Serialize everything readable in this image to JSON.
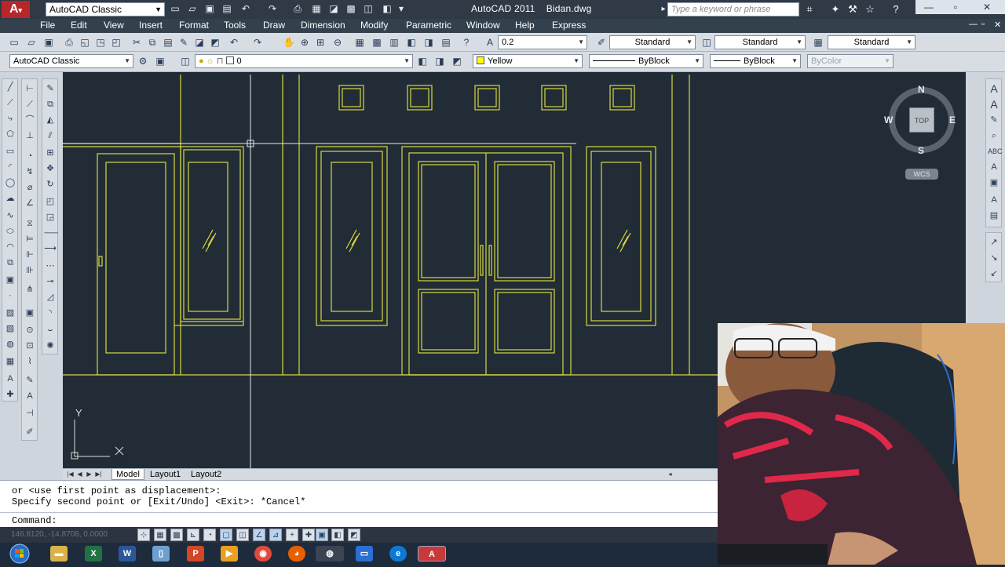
{
  "titlebar": {
    "workspace": "AutoCAD Classic",
    "app_title": "AutoCAD 2011",
    "doc_title": "Bidan.dwg",
    "search_placeholder": "Type a keyword or phrase"
  },
  "menu": [
    "File",
    "Edit",
    "View",
    "Insert",
    "Format",
    "Tools",
    "Draw",
    "Dimension",
    "Modify",
    "Parametric",
    "Window",
    "Help",
    "Express"
  ],
  "toolbar1": {
    "text_height": "0.2",
    "text_style": "Standard",
    "dim_style": "Standard",
    "table_style": "Standard"
  },
  "toolbar2": {
    "workspace": "AutoCAD Classic",
    "layer": "0",
    "color": "Yellow",
    "color_hex": "#ffff00",
    "linetype": "ByBlock",
    "lineweight": "ByBlock",
    "plotstyle": "ByColor"
  },
  "viewcube": {
    "north": "N",
    "south": "S",
    "east": "E",
    "west": "W",
    "face": "TOP",
    "ucs": "WCS"
  },
  "ucs_icon": {
    "y": "Y"
  },
  "tabs": {
    "model": "Model",
    "layout1": "Layout1",
    "layout2": "Layout2"
  },
  "command": {
    "line1": "or <use first point as displacement>:",
    "line2": "Specify second point or [Exit/Undo] <Exit>: *Cancel*",
    "prompt": "Command:"
  },
  "status": {
    "coords": "146.8120, -14.8708, 0.0000"
  },
  "colors": {
    "drawing_bg": "#212c36",
    "drawing_line": "#d8d840",
    "crosshair": "#e8e8e8"
  },
  "taskbar_apps": [
    "folder-icon",
    "excel-icon",
    "word-icon",
    "files-icon",
    "powerpoint-icon",
    "media-icon",
    "chrome-icon",
    "firefox-icon",
    "obs-icon",
    "app-icon",
    "edge-icon",
    "autocad-icon"
  ]
}
